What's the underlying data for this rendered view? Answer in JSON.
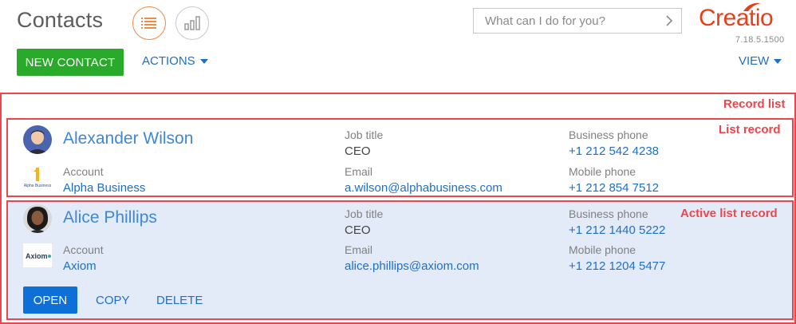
{
  "header": {
    "title": "Contacts",
    "search_placeholder": "What can I do for you?",
    "logo_text": "Creatio",
    "version": "7.18.5.1500"
  },
  "toolbar": {
    "new_contact_label": "NEW CONTACT",
    "actions_label": "ACTIONS",
    "view_label": "VIEW"
  },
  "annotations": {
    "record_list": "Record list",
    "list_record": "List record",
    "active_list_record": "Active list record"
  },
  "captions": {
    "account": "Account",
    "job_title": "Job title",
    "email": "Email",
    "business_phone": "Business phone",
    "mobile_phone": "Mobile phone"
  },
  "records": [
    {
      "name": "Alexander Wilson",
      "account": "Alpha Business",
      "account_logo_text": "Alpha Business",
      "job_title": "CEO",
      "email": "a.wilson@alphabusiness.com",
      "business_phone": "+1 212 542 4238",
      "mobile_phone": "+1 212 854 7512"
    },
    {
      "name": "Alice Phillips",
      "account": "Axiom",
      "account_logo_text": "Axiom",
      "job_title": "CEO",
      "email": "alice.phillips@axiom.com",
      "business_phone": "+1 212 1440 5222",
      "mobile_phone": "+1 212 1204 5477"
    }
  ],
  "active_actions": {
    "open_label": "OPEN",
    "copy_label": "COPY",
    "delete_label": "DELETE"
  },
  "colors": {
    "accent_orange": "#f08a45",
    "brand_red": "#e5401a",
    "link_blue": "#1e6fc8",
    "primary_green": "#2aaa2a",
    "annotation_red": "#e8474e",
    "active_row_bg": "#e4ebf8"
  },
  "icons": {
    "list_view": "list-icon",
    "analytics_view": "bar-chart-icon",
    "search_go": "chevron-right-icon"
  }
}
